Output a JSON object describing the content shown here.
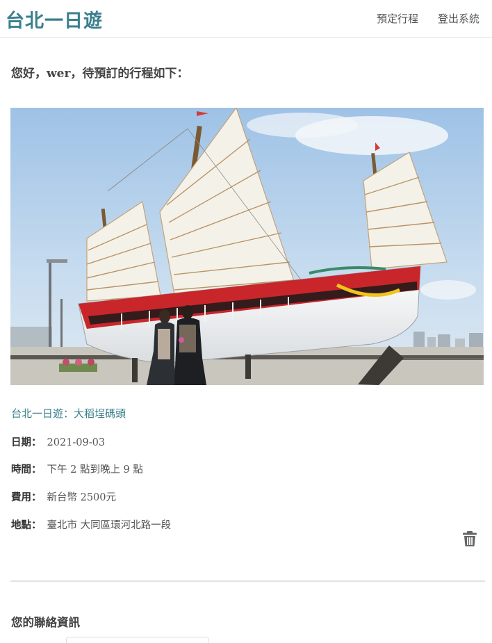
{
  "navbar": {
    "brand": "台北一日遊",
    "links": [
      {
        "label": "預定行程"
      },
      {
        "label": "登出系統"
      }
    ]
  },
  "booking": {
    "greeting": "您好，wer，待預訂的行程如下：",
    "tour_title": "台北一日遊：大稻埕碼頭",
    "date_label": "日期：",
    "date_value": "2021-09-03",
    "time_label": "時間：",
    "time_value": "下午 2 點到晚上 9 點",
    "fee_label": "費用：",
    "fee_value": "新台幣 2500元",
    "location_label": "地點：",
    "location_value": "臺北市 大同區環河北路一段"
  },
  "contact": {
    "title": "您的聯絡資訊",
    "name_value": ""
  },
  "icons": {
    "delete": "trash-icon"
  },
  "colors": {
    "brand": "#3b7f8c",
    "text": "#444444",
    "divider": "#e2e2e2"
  }
}
